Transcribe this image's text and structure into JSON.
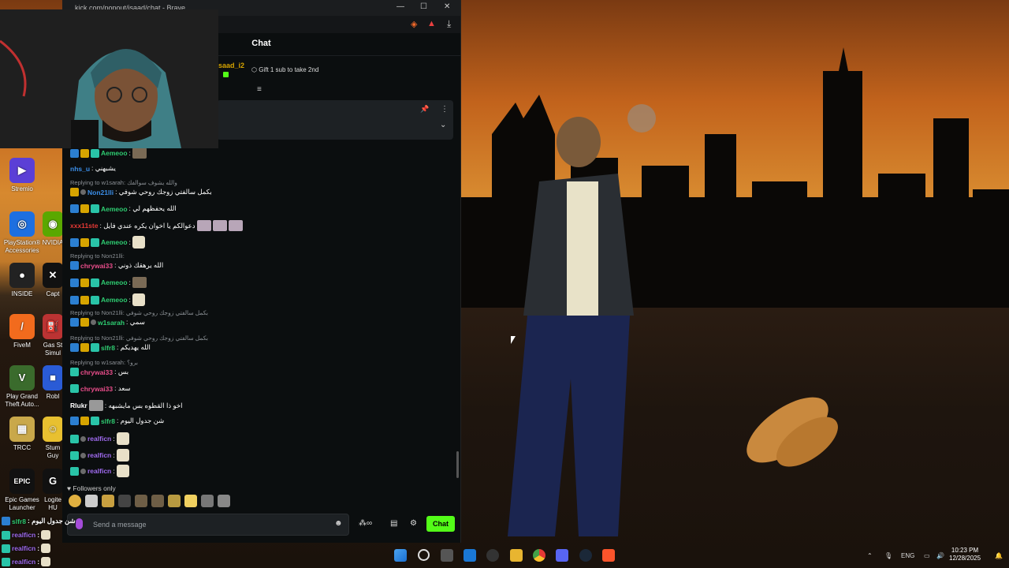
{
  "browser": {
    "url": "kick.com/popout/isaad/chat - Brave",
    "chat_title": "Chat",
    "streamer_name": "saad_i2",
    "gift_text": "Gift 1 sub to take 2nd"
  },
  "desktop_icons": [
    {
      "label": "Stremio"
    },
    {
      "label": "PlayStation® Accessories"
    },
    {
      "label": "NVIDIA"
    },
    {
      "label": "INSIDE"
    },
    {
      "label": "Capt"
    },
    {
      "label": "FiveM"
    },
    {
      "label": "Gas St Simul"
    },
    {
      "label": "Play Grand Theft Auto..."
    },
    {
      "label": "Robl"
    },
    {
      "label": "TRCC"
    },
    {
      "label": "Stum Guy"
    },
    {
      "label": "Epic Games Launcher"
    },
    {
      "label": "Logite HU"
    }
  ],
  "messages": [
    {
      "user": "Aemeoo",
      "text": ":",
      "color": "#2ecc71"
    },
    {
      "user": "nhs_u",
      "text": ": يشبهني",
      "color": "#3b8ee8"
    },
    {
      "reply": "Replying to w1sarah: والله يشوف سوالفك"
    },
    {
      "user": "Non21lli",
      "text": ": بكمل سالفتي زوجك روحي شوفي",
      "color": "#3b8ee8"
    },
    {
      "user": "Aemeoo",
      "text": ": الله يحفظهم لي",
      "color": "#2ecc71"
    },
    {
      "user": "xxx11ste",
      "text": ": دعوالكم يا اخوان يكره عندي فايل",
      "color": "#e53935"
    },
    {
      "user": "Aemeoo",
      "text": ":",
      "color": "#2ecc71"
    },
    {
      "reply": "Replying to Non21lli:"
    },
    {
      "user": "chrywai33",
      "text": ": الله يرهقك ذوني",
      "color": "#e84d8a"
    },
    {
      "user": "Aemeoo",
      "text": ":",
      "color": "#2ecc71"
    },
    {
      "user": "Aemeoo",
      "text": ":",
      "color": "#2ecc71"
    },
    {
      "reply": "Replying to Non21lli: بكمل سالفتي زوجك روحي شوفي"
    },
    {
      "user": "w1sarah",
      "text": ": سمي",
      "color": "#2ecc71"
    },
    {
      "reply": "Replying to Non21lli: بكمل سالفتي زوجك روحي شوفي"
    },
    {
      "user": "slfr8",
      "text": ": الله يهديكم",
      "color": "#2ecc71"
    },
    {
      "reply": "Replying to w1sarah: برو؟"
    },
    {
      "user": "chrywai33",
      "text": ": بس",
      "color": "#e84d8a"
    },
    {
      "user": "chrywai33",
      "text": ": سعد",
      "color": "#e84d8a"
    },
    {
      "user": "Rlukr",
      "text": ": اخو ذا القطوه بس مايشبهه",
      "color": "#ffffff"
    },
    {
      "user": "slfr8",
      "text": ": شن جدول اليوم",
      "color": "#2ecc71"
    },
    {
      "user": "realficn",
      "text": ":",
      "color": "#a06bf0"
    },
    {
      "user": "realficn",
      "text": ":",
      "color": "#a06bf0"
    },
    {
      "user": "realficn",
      "text": ":",
      "color": "#a06bf0"
    }
  ],
  "followers_only": "Followers only",
  "input_placeholder": "Send a message",
  "chat_button": "Chat",
  "overlay": [
    {
      "user": "slfr8",
      "text": ": شن جدول اليوم",
      "color": "#2ecc71"
    },
    {
      "user": "realficn",
      "text": ":",
      "color": "#a06bf0"
    },
    {
      "user": "realficn",
      "text": ":",
      "color": "#a06bf0"
    },
    {
      "user": "realficn",
      "text": ":",
      "color": "#a06bf0"
    }
  ],
  "tray": {
    "lang": "ENG",
    "time": "10:23 PM",
    "date": "12/28/2025"
  },
  "colors": {
    "kick_green": "#53fc18",
    "chat_bg": "#0b0e0f"
  }
}
